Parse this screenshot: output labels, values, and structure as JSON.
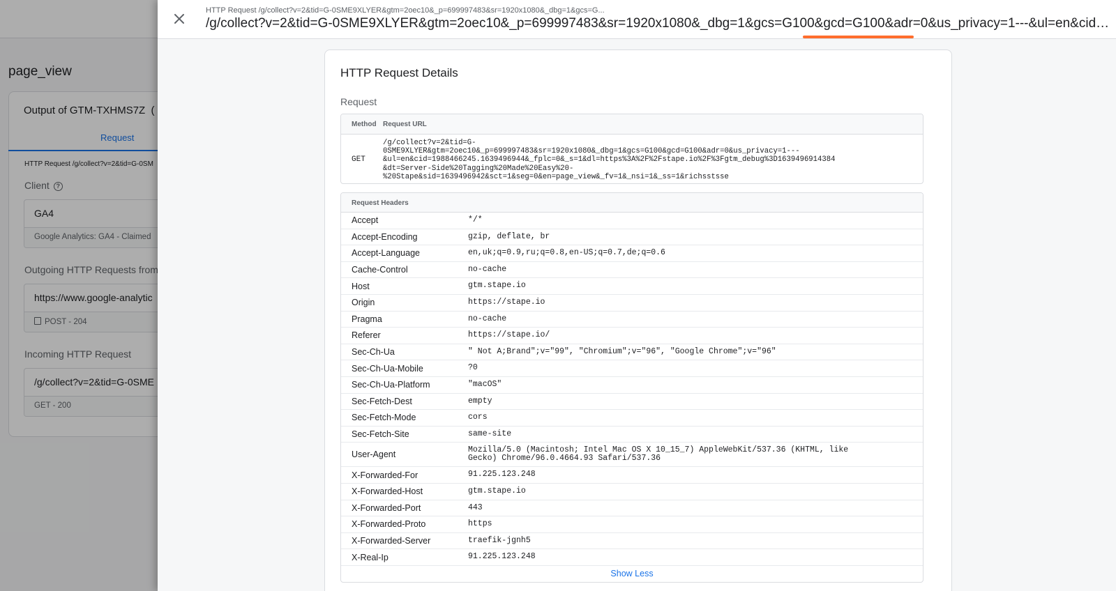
{
  "background": {
    "event_title": "page_view",
    "card_title": "Output of GTM-TXHMS7Z",
    "card_title_suffix": "(",
    "tab_request": "Request",
    "http_line": "HTTP Request /g/collect?v=2&tid=G-0SM",
    "client_label": "Client",
    "help_icon": "?",
    "client_value": "GA4",
    "client_sub": "Google Analytics: GA4 - Claimed",
    "outgoing_label": "Outgoing HTTP Requests from",
    "outgoing_value": "https://www.google-analytic",
    "outgoing_sub": "POST - 204",
    "incoming_label": "Incoming HTTP Request",
    "incoming_value": "/g/collect?v=2&tid=G-0SME",
    "incoming_sub": "GET - 200"
  },
  "drawer": {
    "subtitle": "HTTP Request /g/collect?v=2&tid=G-0SME9XLYER&gtm=2oec10&_p=699997483&sr=1920x1080&_dbg=1&gcs=G...",
    "title": "/g/collect?v=2&tid=G-0SME9XLYER&gtm=2oec10&_p=699997483&sr=1920x1080&_dbg=1&gcs=G100&gcd=G100&adr=0&us_privacy=1---&ul=en&cid=...",
    "highlight_color": "#ff6d2d"
  },
  "details": {
    "title": "HTTP Request Details",
    "request_label": "Request",
    "col_method": "Method",
    "col_url": "Request URL",
    "method": "GET",
    "url": "/g/collect?v=2&tid=G-\n0SME9XLYER&gtm=2oec10&_p=699997483&sr=1920x1080&_dbg=1&gcs=G100&gcd=G100&adr=0&us_privacy=1---\n&ul=en&cid=1988466245.1639496944&_fplc=0&_s=1&dl=https%3A%2F%2Fstape.io%2F%3Fgtm_debug%3D1639496914384\n&dt=Server-Side%20Tagging%20Made%20Easy%20-\n%20Stape&sid=1639496942&sct=1&seg=0&en=page_view&_fv=1&_nsi=1&_ss=1&richsstsse",
    "headers_label": "Request Headers",
    "headers": [
      {
        "name": "Accept",
        "value": "*/*"
      },
      {
        "name": "Accept-Encoding",
        "value": "gzip, deflate, br"
      },
      {
        "name": "Accept-Language",
        "value": "en,uk;q=0.9,ru;q=0.8,en-US;q=0.7,de;q=0.6"
      },
      {
        "name": "Cache-Control",
        "value": "no-cache"
      },
      {
        "name": "Host",
        "value": "gtm.stape.io"
      },
      {
        "name": "Origin",
        "value": "https://stape.io"
      },
      {
        "name": "Pragma",
        "value": "no-cache"
      },
      {
        "name": "Referer",
        "value": "https://stape.io/"
      },
      {
        "name": "Sec-Ch-Ua",
        "value": "\" Not A;Brand\";v=\"99\", \"Chromium\";v=\"96\", \"Google Chrome\";v=\"96\""
      },
      {
        "name": "Sec-Ch-Ua-Mobile",
        "value": "?0"
      },
      {
        "name": "Sec-Ch-Ua-Platform",
        "value": "\"macOS\""
      },
      {
        "name": "Sec-Fetch-Dest",
        "value": "empty"
      },
      {
        "name": "Sec-Fetch-Mode",
        "value": "cors"
      },
      {
        "name": "Sec-Fetch-Site",
        "value": "same-site"
      },
      {
        "name": "User-Agent",
        "value": "Mozilla/5.0 (Macintosh; Intel Mac OS X 10_15_7) AppleWebKit/537.36 (KHTML, like\nGecko) Chrome/96.0.4664.93 Safari/537.36"
      },
      {
        "name": "X-Forwarded-For",
        "value": "91.225.123.248"
      },
      {
        "name": "X-Forwarded-Host",
        "value": "gtm.stape.io"
      },
      {
        "name": "X-Forwarded-Port",
        "value": "443"
      },
      {
        "name": "X-Forwarded-Proto",
        "value": "https"
      },
      {
        "name": "X-Forwarded-Server",
        "value": "traefik-jgnh5"
      },
      {
        "name": "X-Real-Ip",
        "value": "91.225.123.248"
      }
    ],
    "show_less": "Show Less"
  }
}
